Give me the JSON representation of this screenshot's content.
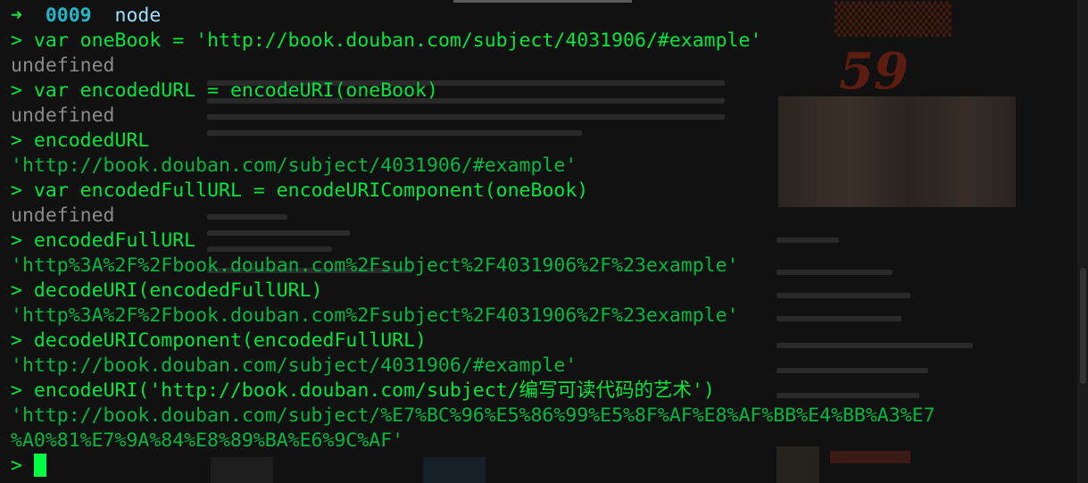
{
  "prompt": {
    "arrow": "➜",
    "counter": "0009",
    "command": "node"
  },
  "repl_prompt": ">",
  "lines": [
    {
      "kind": "input",
      "text": "var oneBook = 'http://book.douban.com/subject/4031906/#example'"
    },
    {
      "kind": "undef",
      "text": "undefined"
    },
    {
      "kind": "input",
      "text": "var encodedURL = encodeURI(oneBook)"
    },
    {
      "kind": "undef",
      "text": "undefined"
    },
    {
      "kind": "input",
      "text": "encodedURL"
    },
    {
      "kind": "string",
      "text": "'http://book.douban.com/subject/4031906/#example'"
    },
    {
      "kind": "input",
      "text": "var encodedFullURL = encodeURIComponent(oneBook)"
    },
    {
      "kind": "undef",
      "text": "undefined"
    },
    {
      "kind": "input",
      "text": "encodedFullURL"
    },
    {
      "kind": "string",
      "text": "'http%3A%2F%2Fbook.douban.com%2Fsubject%2F4031906%2F%23example'"
    },
    {
      "kind": "input",
      "text": "decodeURI(encodedFullURL)"
    },
    {
      "kind": "string",
      "text": "'http%3A%2F%2Fbook.douban.com%2Fsubject%2F4031906%2F%23example'"
    },
    {
      "kind": "input",
      "text": "decodeURIComponent(encodedFullURL)"
    },
    {
      "kind": "string",
      "text": "'http://book.douban.com/subject/4031906/#example'"
    },
    {
      "kind": "input",
      "text": "encodeURI('http://book.douban.com/subject/编写可读代码的艺术')"
    },
    {
      "kind": "string",
      "text": "'http://book.douban.com/subject/%E7%BC%96%E5%86%99%E5%8F%AF%E8%AF%BB%E4%BB%A3%E7"
    },
    {
      "kind": "string",
      "text": "%A0%81%E7%9A%84%E8%89%BA%E6%9C%AF'"
    }
  ],
  "background_page": {
    "promo_number": "59"
  },
  "colors": {
    "terminal_bg": "#111111",
    "input_green": "#00e63c",
    "string_green": "#00b840",
    "undefined_gray": "#8a8a8a",
    "counter_cyan": "#20b8c8",
    "cursor_green": "#00ff44"
  }
}
